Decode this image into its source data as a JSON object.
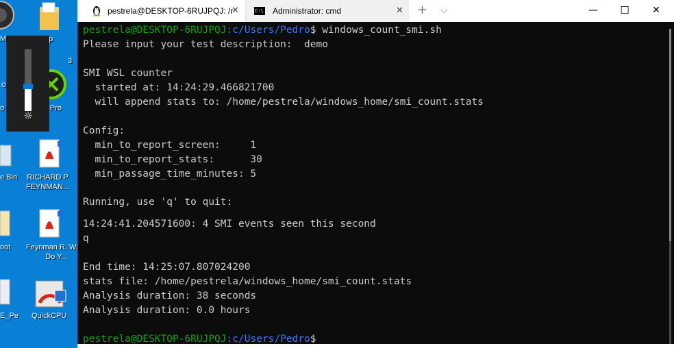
{
  "desktop": {
    "icons": [
      {
        "label": "Mi"
      },
      {
        "label": "mp"
      },
      {
        "label": "o"
      },
      {
        "label": "3"
      },
      {
        "label": "o"
      },
      {
        "label": "er Pro"
      },
      {
        "label": "e Bin"
      },
      {
        "label": "RICHARD P FEYNMAN..."
      },
      {
        "label": "oot"
      },
      {
        "label": "Feynman R. What Do Y..."
      },
      {
        "label": "E_Pe"
      },
      {
        "label": "QuickCPU"
      }
    ]
  },
  "tabs": [
    {
      "label": "pestrela@DESKTOP-6RUJPQJ: /r",
      "close": "✕",
      "icon": "linux-penguin-icon"
    },
    {
      "label": "Administrator: cmd",
      "close": "✕",
      "icon": "cmd-icon"
    }
  ],
  "toolbar": {
    "new_tab": "+",
    "dropdown": "⌵"
  },
  "window_controls": {
    "minimize": "—",
    "maximize": "☐",
    "close": "✕"
  },
  "colors": {
    "prompt_user": "#13a10e",
    "prompt_path": "#3b78ff",
    "text": "#cccccc",
    "background": "#0c0c0c"
  },
  "terminal": {
    "prompt1": {
      "user": "pestrela@DESKTOP-6RUJPQJ",
      "path": ":c/Users/Pedro",
      "symbol": "$",
      "command": " windows_count_smi.sh"
    },
    "lines": [
      "Please input your test description:  demo",
      "SMI WSL counter",
      "  started at: 14:24:29.466821700",
      "  will append stats to: /home/pestrela/windows_home/smi_count.stats",
      "Config:",
      "  min_to_report_screen:     1",
      "  min_to_report_stats:      30",
      "  min_passage_time_minutes: 5",
      "Running, use 'q' to quit:",
      "14:24:41.204571600: 4 SMI events seen this second",
      "q",
      "End time: 14:25:07.807024200",
      "stats file: /home/pestrela/windows_home/smi_count.stats",
      "Analysis duration: 38 seconds",
      "Analysis duration: 0.0 hours"
    ],
    "prompt2": {
      "user": "pestrela@DESKTOP-6RUJPQJ",
      "path": ":c/Users/Pedro",
      "symbol": "$"
    }
  }
}
